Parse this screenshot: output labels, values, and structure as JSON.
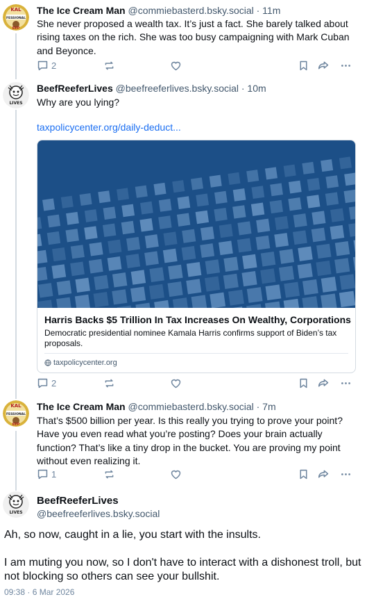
{
  "posts": [
    {
      "author": "The Ice Cream Man",
      "handle": "@commiebasterd.bsky.social",
      "time": "· 11m",
      "text": "She never proposed a wealth tax. It’s just a fact. She barely talked about rising taxes on the rich. She was too busy campaigning with Mark Cuban and Beyonce.",
      "reply_count": "2",
      "avatar_text_top": "KAL",
      "avatar_text_mid": "FESSIONAL",
      "avatar_text_bot": "EEP"
    },
    {
      "author": "BeefReeferLives",
      "handle": "@beefreeferlives.bsky.social",
      "time": "· 10m",
      "text": "Why are you lying?",
      "link": "taxpolicycenter.org/daily-deduct...",
      "reply_count": "2",
      "avatar_text": "LIVES",
      "card": {
        "title": "Harris Backs $5 Trillion In Tax Increases On Wealthy, Corporations",
        "description": "Democratic presidential nominee Kamala Harris confirms support of Biden’s tax proposals.",
        "domain": "taxpolicycenter.org"
      }
    },
    {
      "author": "The Ice Cream Man",
      "handle": "@commiebasterd.bsky.social",
      "time": "· 7m",
      "text": "That’s $500 billion per year. Is this really you trying to prove your point? Have you even read what you’re posting? Does your brain actually function? That’s like a tiny drop in the bucket. You are proving my point without even realizing it.",
      "reply_count": "1",
      "avatar_text_top": "KAL",
      "avatar_text_mid": "FESSIONAL",
      "avatar_text_bot": "EEP"
    }
  ],
  "main_post": {
    "author": "BeefReeferLives",
    "handle": "@beefreeferlives.bsky.social",
    "paragraph1": "Ah, so now, caught in a lie, you start with the insults.",
    "paragraph2": "I am muting you now, so I don't have to interact with a dishonest troll, but not blocking so others can see your bullshit.",
    "date": "09:38 · 6 Mar 2026",
    "avatar_text": "LIVES"
  },
  "icons": [
    "reply-icon",
    "repost-icon",
    "like-icon",
    "bookmark-icon",
    "share-icon",
    "more-icon",
    "globe-icon"
  ],
  "colors": {
    "link": "#1a6ef2",
    "muted": "#42576c",
    "action": "#6f869f",
    "card_image": "#1c4f87"
  }
}
